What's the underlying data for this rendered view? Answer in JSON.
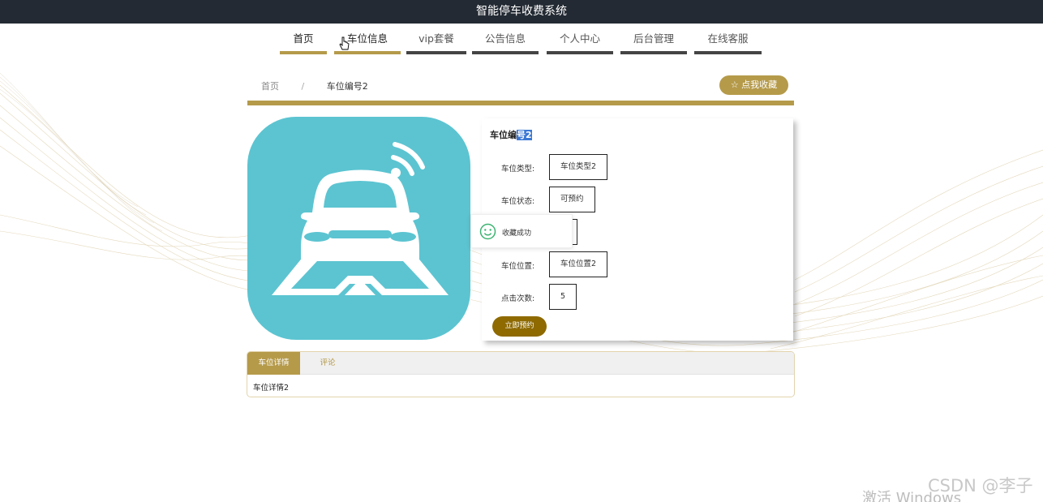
{
  "header": {
    "title": "智能停车收费系统"
  },
  "nav": {
    "items": [
      {
        "label": "首页",
        "active": true
      },
      {
        "label": "车位信息",
        "active": true
      },
      {
        "label": "vip套餐",
        "active": false
      },
      {
        "label": "公告信息",
        "active": false
      },
      {
        "label": "个人中心",
        "active": false
      },
      {
        "label": "后台管理",
        "active": false
      },
      {
        "label": "在线客服",
        "active": false
      }
    ]
  },
  "breadcrumb": {
    "home": "首页",
    "separator": "/",
    "current": "车位编号2"
  },
  "favorite_button": {
    "icon": "star-icon",
    "label": "☆ 点我收藏"
  },
  "detail": {
    "title_prefix": "车位编",
    "title_selected": "号2",
    "fields": [
      {
        "label": "车位类型:",
        "value": "车位类型2"
      },
      {
        "label": "车位状态:",
        "value": "可预约"
      },
      {
        "label": "",
        "value": ""
      },
      {
        "label": "车位位置:",
        "value": "车位位置2"
      },
      {
        "label": "点击次数:",
        "value": "5"
      }
    ],
    "reserve_label": "立即预约"
  },
  "toast": {
    "icon": "smile-icon",
    "text": "收藏成功"
  },
  "tabs": {
    "items": [
      {
        "label": "车位详情",
        "active": true
      },
      {
        "label": "评论",
        "active": false
      }
    ],
    "content": "车位详情2"
  },
  "overlay": {
    "watermark": "CSDN @李子b",
    "activate_windows": "激活 Windows"
  },
  "colors": {
    "accent": "#b59a4a",
    "header_bg": "#232a33",
    "reserve": "#8e6a00",
    "car_bg": "#5cc4d1"
  }
}
